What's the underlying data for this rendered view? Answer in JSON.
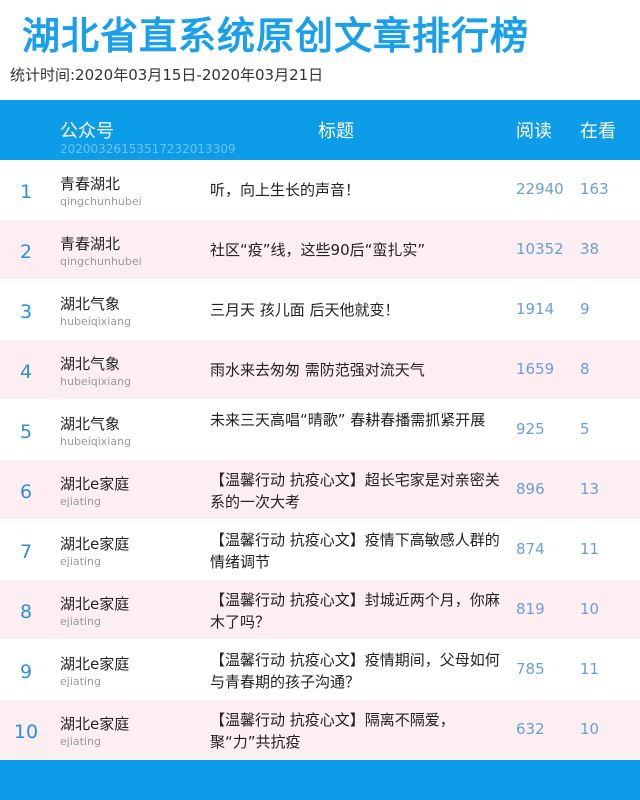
{
  "title": "湖北省直系统原创文章排行榜",
  "period": "统计时间:2020年03月15日-2020年03月21日",
  "header": {
    "account": "公众号",
    "title": "标题",
    "read": "阅读",
    "watch": "在看",
    "code": "20200326153517232013309"
  },
  "rows": [
    {
      "rank": "1",
      "name": "青春湖北",
      "id": "qingchunhubei",
      "title": "听，向上生长的声音！",
      "read": "22940",
      "watch": "163"
    },
    {
      "rank": "2",
      "name": "青春湖北",
      "id": "qingchunhubei",
      "title": "社区“疫”线，这些90后“蛮扎实”",
      "read": "10352",
      "watch": "38"
    },
    {
      "rank": "3",
      "name": "湖北气象",
      "id": "hubeiqixiang",
      "title": "三月天 孩儿面 后天他就变！",
      "read": "1914",
      "watch": "9"
    },
    {
      "rank": "4",
      "name": "湖北气象",
      "id": "hubeiqixiang",
      "title": "雨水来去匆匆 需防范强对流天气",
      "read": "1659",
      "watch": "8"
    },
    {
      "rank": "5",
      "name": "湖北气象",
      "id": "hubeiqixiang",
      "title": "未来三天高唱“晴歌” 春耕春播需抓紧开展",
      "read": "925",
      "watch": "5"
    },
    {
      "rank": "6",
      "name": "湖北e家庭",
      "id": "ejiating",
      "title": "【温馨行动 抗疫心文】超长宅家是对亲密关系的一次大考",
      "read": "896",
      "watch": "13"
    },
    {
      "rank": "7",
      "name": "湖北e家庭",
      "id": "ejiating",
      "title": "【温馨行动 抗疫心文】疫情下高敏感人群的情绪调节",
      "read": "874",
      "watch": "11"
    },
    {
      "rank": "8",
      "name": "湖北e家庭",
      "id": "ejiating",
      "title": "【温馨行动 抗疫心文】封城近两个月，你麻木了吗？",
      "read": "819",
      "watch": "10"
    },
    {
      "rank": "9",
      "name": "湖北e家庭",
      "id": "ejiating",
      "title": "【温馨行动 抗疫心文】疫情期间，父母如何与青春期的孩子沟通？",
      "read": "785",
      "watch": "11"
    },
    {
      "rank": "10",
      "name": "湖北e家庭",
      "id": "ejiating",
      "title": "【温馨行动 抗疫心文】隔离不隔爱，聚“力”共抗疫",
      "read": "632",
      "watch": "10"
    }
  ]
}
